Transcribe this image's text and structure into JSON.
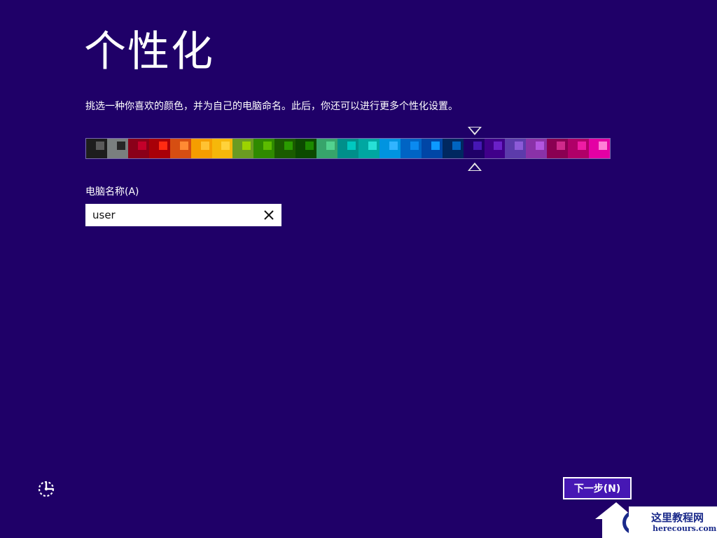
{
  "title": "个性化",
  "subtitle": "挑选一种你喜欢的颜色，并为自己的电脑命名。此后，你还可以进行更多个性化设置。",
  "colors": [
    {
      "bg": "#1d1d1d",
      "accent": "#5a5a5a"
    },
    {
      "bg": "#7a7f7f",
      "accent": "#262626"
    },
    {
      "bg": "#8a0019",
      "accent": "#c4002a"
    },
    {
      "bg": "#a80008",
      "accent": "#ff2b12"
    },
    {
      "bg": "#d64e12",
      "accent": "#ff8a33"
    },
    {
      "bg": "#f59d00",
      "accent": "#ffc233"
    },
    {
      "bg": "#f6b70a",
      "accent": "#ffd23a"
    },
    {
      "bg": "#6b9b22",
      "accent": "#9cd300"
    },
    {
      "bg": "#2f8a00",
      "accent": "#5cbb00"
    },
    {
      "bg": "#1a5b00",
      "accent": "#2a9b00"
    },
    {
      "bg": "#0c4a00",
      "accent": "#1c8a00"
    },
    {
      "bg": "#37a46b",
      "accent": "#52d28f"
    },
    {
      "bg": "#008f8a",
      "accent": "#00c8c0"
    },
    {
      "bg": "#00a7a1",
      "accent": "#27e0d6"
    },
    {
      "bg": "#0094e0",
      "accent": "#31b4ff"
    },
    {
      "bg": "#0064c4",
      "accent": "#0a8af0"
    },
    {
      "bg": "#0046a6",
      "accent": "#0c9aff"
    },
    {
      "bg": "#002860",
      "accent": "#0064c0"
    },
    {
      "bg": "#1f0068",
      "accent": "#4617b4"
    },
    {
      "bg": "#40008a",
      "accent": "#6a20c8"
    },
    {
      "bg": "#5c3bab",
      "accent": "#8c5ad8"
    },
    {
      "bg": "#8a32a8",
      "accent": "#b355e0"
    },
    {
      "bg": "#8a0052",
      "accent": "#cf2a8b"
    },
    {
      "bg": "#b00068",
      "accent": "#ef1ca4"
    },
    {
      "bg": "#e400a4",
      "accent": "#ff7fd6"
    }
  ],
  "pc_name_label": "电脑名称(A)",
  "pc_name_value": "user",
  "next_button": "下一步(N)",
  "watermark": {
    "site_name": "这里教程网",
    "domain": "herecours.com"
  }
}
